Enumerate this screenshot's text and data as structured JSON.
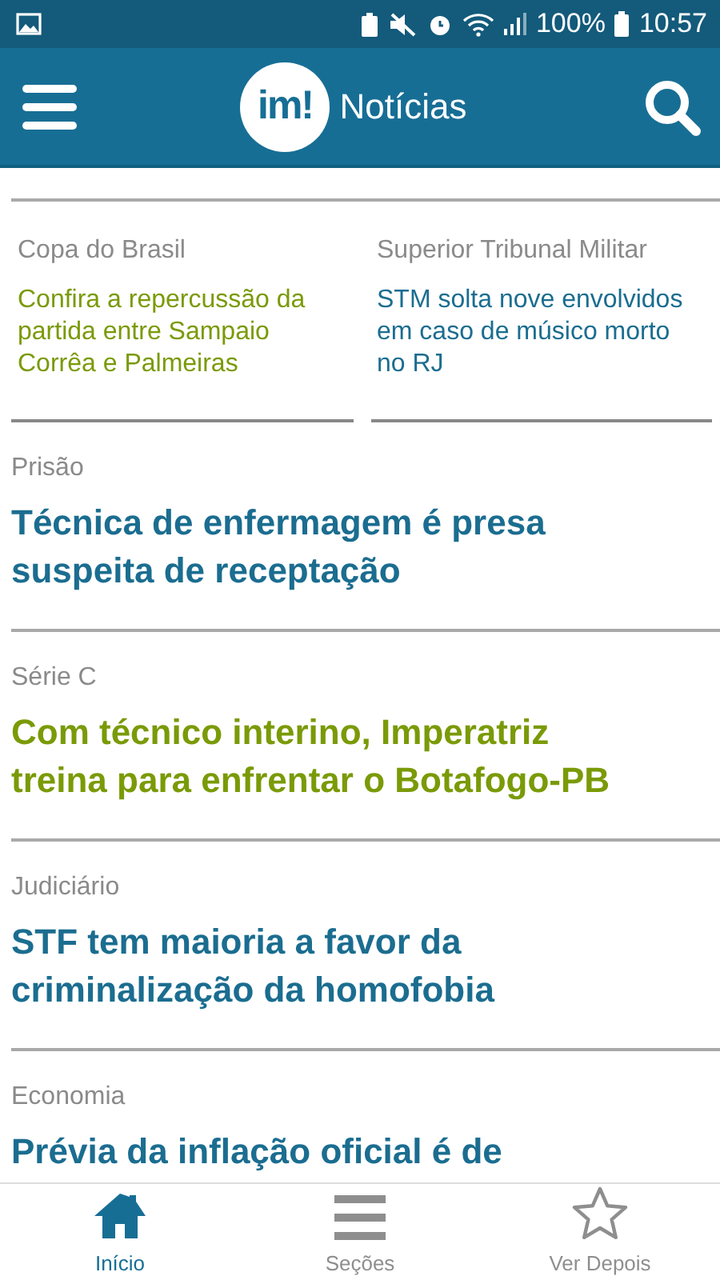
{
  "status_bar": {
    "battery": "100%",
    "time": "10:57"
  },
  "header": {
    "logo": "im!",
    "title": "Notícias"
  },
  "featured": [
    {
      "category": "Copa do Brasil",
      "headline": "Confira a repercussão da partida entre Sampaio Corrêa e Palmeiras",
      "color": "#7a9a07"
    },
    {
      "category": "Superior Tribunal Militar",
      "headline": "STM solta nove envolvidos em caso de músico morto no RJ",
      "color": "#1b6d90"
    }
  ],
  "articles": [
    {
      "category": "Prisão",
      "headline": "Técnica de enfermagem é presa suspeita de receptação",
      "color": "#1b6d90"
    },
    {
      "category": "Série C",
      "headline": "Com técnico interino, Imperatriz treina para enfrentar o Botafogo-PB",
      "color": "#7a9a07"
    },
    {
      "category": "Judiciário",
      "headline": "STF tem maioria a favor da criminalização da homofobia",
      "color": "#1b6d90"
    },
    {
      "category": "Economia",
      "headline": "Prévia da inflação oficial é de",
      "color": "#1b6d90"
    }
  ],
  "nav": [
    {
      "kind": "home",
      "label": "Início",
      "selected": true
    },
    {
      "kind": "sections",
      "label": "Seções",
      "selected": false
    },
    {
      "kind": "star",
      "label": "Ver Depois",
      "selected": false
    }
  ]
}
